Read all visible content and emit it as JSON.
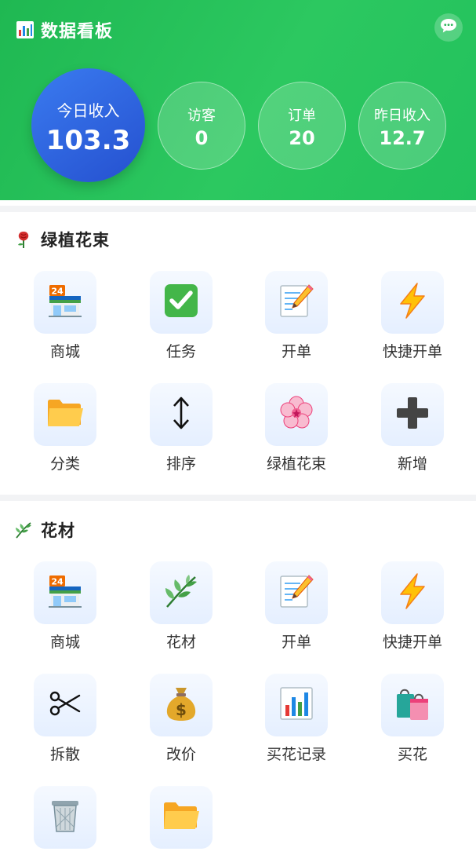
{
  "header": {
    "title": "数据看板",
    "today_income": {
      "label": "今日收入",
      "value": "103.3"
    },
    "stats": [
      {
        "label": "访客",
        "value": "0"
      },
      {
        "label": "订单",
        "value": "20"
      },
      {
        "label": "昨日收入",
        "value": "12.7"
      }
    ]
  },
  "sections": [
    {
      "title": "绿植花束",
      "icon": "rose-icon",
      "items": [
        {
          "label": "商城",
          "icon": "store-24-icon"
        },
        {
          "label": "任务",
          "icon": "check-mark-icon"
        },
        {
          "label": "开单",
          "icon": "memo-pencil-icon"
        },
        {
          "label": "快捷开单",
          "icon": "lightning-icon"
        },
        {
          "label": "分类",
          "icon": "folder-icon"
        },
        {
          "label": "排序",
          "icon": "up-down-arrow-icon"
        },
        {
          "label": "绿植花束",
          "icon": "cherry-blossom-icon"
        },
        {
          "label": "新增",
          "icon": "plus-icon"
        }
      ]
    },
    {
      "title": "花材",
      "icon": "herb-icon",
      "items": [
        {
          "label": "商城",
          "icon": "store-24-icon"
        },
        {
          "label": "花材",
          "icon": "herb-icon"
        },
        {
          "label": "开单",
          "icon": "memo-pencil-icon"
        },
        {
          "label": "快捷开单",
          "icon": "lightning-icon"
        },
        {
          "label": "拆散",
          "icon": "scissors-icon"
        },
        {
          "label": "改价",
          "icon": "money-bag-icon"
        },
        {
          "label": "买花记录",
          "icon": "bar-chart-icon"
        },
        {
          "label": "买花",
          "icon": "shopping-bags-icon"
        },
        {
          "label": "",
          "icon": "trash-bin-icon"
        },
        {
          "label": "",
          "icon": "folder-icon"
        }
      ]
    }
  ],
  "colors": {
    "header_green": "#22c15d",
    "income_blue": "#2f63e0",
    "tile_bg": "#e8f1ff"
  }
}
